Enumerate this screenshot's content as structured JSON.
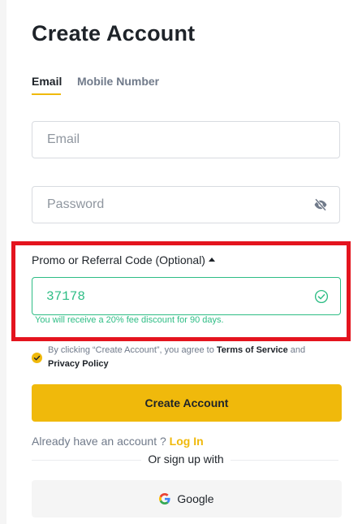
{
  "page_title": "Create Account",
  "tabs": [
    {
      "label": "Email",
      "active": true
    },
    {
      "label": "Mobile Number",
      "active": false
    }
  ],
  "email": {
    "placeholder": "Email",
    "value": ""
  },
  "password": {
    "placeholder": "Password",
    "value": "",
    "icon": "eye-off-icon"
  },
  "promo": {
    "label": "Promo or Referral Code (Optional)",
    "value": "37178",
    "hint": "You will receive a 20% fee discount for 90 days.",
    "icon": "check-circle-icon"
  },
  "agreement": {
    "prefix": "By clicking “Create Account”, you agree to ",
    "terms": "Terms of Service",
    "conjunction": " and ",
    "privacy": "Privacy Policy",
    "checked": true
  },
  "create_button": "Create Account",
  "login_prompt": {
    "text": "Already have an account ? ",
    "link": "Log In"
  },
  "or_sign_up": "Or sign up with",
  "google_button": "Google",
  "colors": {
    "accent": "#f0b90b",
    "success": "#2ebd85",
    "highlight": "#e4141e",
    "text": "#1e2329",
    "muted": "#707a8a"
  }
}
